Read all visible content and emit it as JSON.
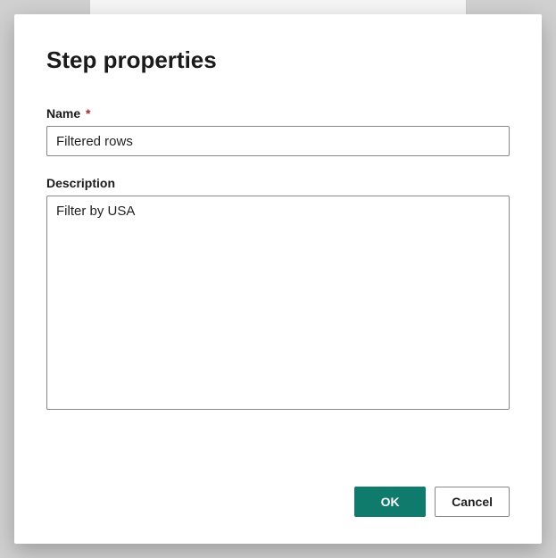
{
  "dialog": {
    "title": "Step properties",
    "name_label": "Name",
    "name_required_marker": "*",
    "name_value": "Filtered rows",
    "description_label": "Description",
    "description_value": "Filter by USA",
    "ok_label": "OK",
    "cancel_label": "Cancel"
  },
  "colors": {
    "primary_button": "#0f7b6c",
    "required_marker": "#a4262c"
  }
}
